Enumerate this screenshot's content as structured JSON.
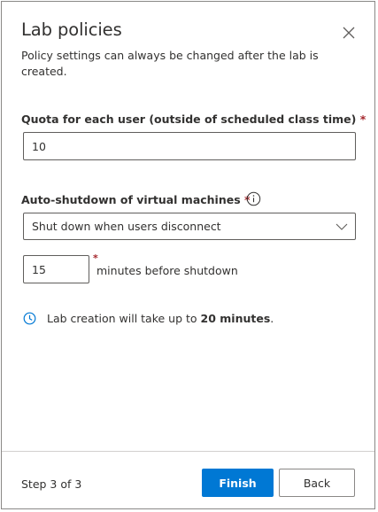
{
  "dialog": {
    "title": "Lab policies",
    "subtitle": "Policy settings can always be changed after the lab is created.",
    "close_icon": "close-icon"
  },
  "quota": {
    "label": "Quota for each user (outside of scheduled class time)",
    "required_mark": "*",
    "value": "10"
  },
  "auto_shutdown": {
    "label": "Auto-shutdown of virtual machines",
    "required_mark": "*",
    "info_icon": "info-icon",
    "selected_option": "Shut down when users disconnect",
    "minutes_value": "15",
    "minutes_required_mark": "*",
    "minutes_label": "minutes before shutdown"
  },
  "note": {
    "icon": "clock-icon",
    "text_prefix": "Lab creation will take up to ",
    "text_bold": "20 minutes",
    "text_suffix": "."
  },
  "footer": {
    "step": "Step 3 of 3",
    "finish_label": "Finish",
    "back_label": "Back"
  },
  "colors": {
    "accent": "#0078d4",
    "required": "#a4262c",
    "text": "#323130",
    "border": "#8a8886"
  }
}
